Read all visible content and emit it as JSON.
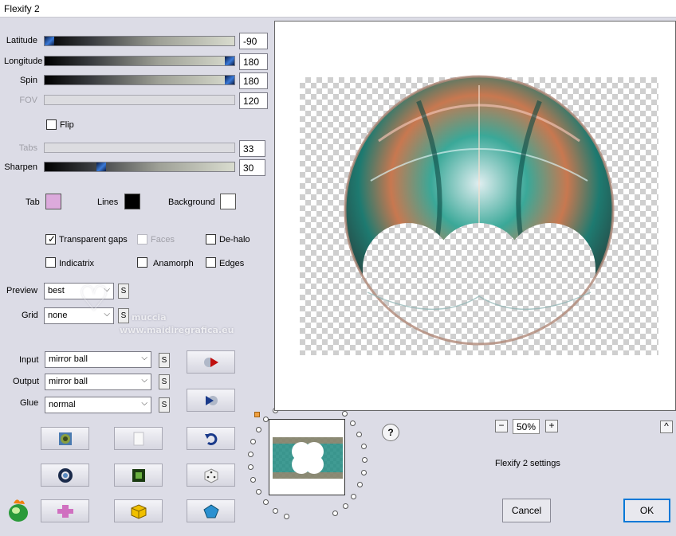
{
  "window": {
    "title": "Flexify 2"
  },
  "sliders": {
    "latitude": {
      "label": "Latitude",
      "value": "-90"
    },
    "longitude": {
      "label": "Longitude",
      "value": "180"
    },
    "spin": {
      "label": "Spin",
      "value": "180"
    },
    "fov": {
      "label": "FOV",
      "value": "120"
    },
    "tabs": {
      "label": "Tabs",
      "value": "33"
    },
    "sharpen": {
      "label": "Sharpen",
      "value": "30"
    }
  },
  "flip": {
    "label": "Flip"
  },
  "colors": {
    "tab": {
      "label": "Tab",
      "color": "#dcaadc"
    },
    "lines": {
      "label": "Lines",
      "color": "#000000"
    },
    "background": {
      "label": "Background",
      "color": "#ffffff"
    }
  },
  "options": {
    "transparent_gaps": "Transparent gaps",
    "faces": "Faces",
    "de_halo": "De-halo",
    "indicatrix": "Indicatrix",
    "anamorph": "Anamorph",
    "edges": "Edges"
  },
  "preview_mode": {
    "label": "Preview",
    "value": "best",
    "s": "S"
  },
  "grid": {
    "label": "Grid",
    "value": "none",
    "s": "S"
  },
  "input": {
    "label": "Input",
    "value": "mirror ball",
    "s": "S"
  },
  "output": {
    "label": "Output",
    "value": "mirror ball",
    "s": "S"
  },
  "glue": {
    "label": "Glue",
    "value": "normal",
    "s": "S"
  },
  "zoom": {
    "minus": "−",
    "value": "50%",
    "plus": "+"
  },
  "help": "?",
  "collapse": "^",
  "settings_caption": "Flexify 2 settings",
  "buttons": {
    "cancel": "Cancel",
    "ok": "OK"
  },
  "watermark": {
    "line1": "muccia",
    "line2": "www.maidiregrafica.eu"
  }
}
